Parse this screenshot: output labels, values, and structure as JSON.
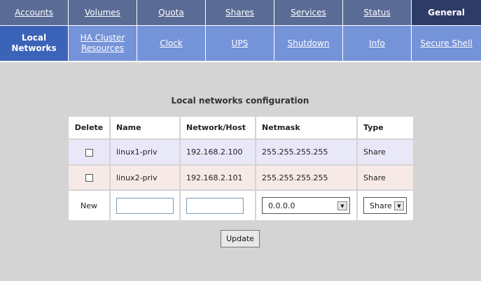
{
  "nav_top": [
    {
      "label": "Accounts"
    },
    {
      "label": "Volumes"
    },
    {
      "label": "Quota"
    },
    {
      "label": "Shares"
    },
    {
      "label": "Services"
    },
    {
      "label": "Status"
    },
    {
      "label": "General",
      "active": true
    }
  ],
  "nav_sub": [
    {
      "label": "Local Networks",
      "active": true
    },
    {
      "label": "HA Cluster Resources"
    },
    {
      "label": "Clock"
    },
    {
      "label": "UPS"
    },
    {
      "label": "Shutdown"
    },
    {
      "label": "Info"
    },
    {
      "label": "Secure Shell"
    }
  ],
  "panel": {
    "title": "Local networks configuration",
    "columns": [
      "Delete",
      "Name",
      "Network/Host",
      "Netmask",
      "Type"
    ],
    "rows": [
      {
        "name": "linux1-priv",
        "network": "192.168.2.100",
        "netmask": "255.255.255.255",
        "type": "Share"
      },
      {
        "name": "linux2-priv",
        "network": "192.168.2.101",
        "netmask": "255.255.255.255",
        "type": "Share"
      }
    ],
    "new_row": {
      "label": "New",
      "name_value": "",
      "network_value": "",
      "netmask_selected": "0.0.0.0",
      "type_selected": "Share"
    },
    "update_label": "Update"
  },
  "colors": {
    "nav_top_bg": "#5a6b95",
    "nav_top_active": "#2e3b66",
    "nav_sub_bg": "#7593d8",
    "nav_sub_active": "#3b63b8",
    "page_bg": "#d4d4d4"
  }
}
